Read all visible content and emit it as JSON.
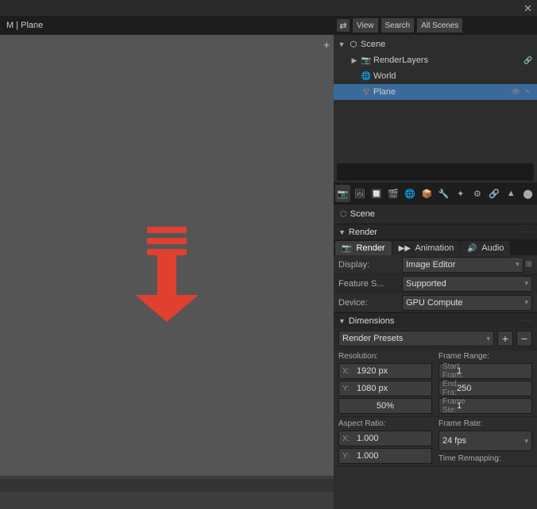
{
  "app": {
    "title": "M | Plane",
    "close_btn": "✕"
  },
  "outliner": {
    "header": {
      "view_label": "View",
      "search_label": "Search",
      "all_scenes_label": "All Scenes"
    },
    "items": [
      {
        "id": "scene",
        "label": "Scene",
        "indent": 0,
        "icon": "🎬",
        "has_arrow": true,
        "expanded": true
      },
      {
        "id": "renderlayers",
        "label": "RenderLayers",
        "indent": 1,
        "icon": "📷",
        "has_arrow": false,
        "expanded": false
      },
      {
        "id": "world",
        "label": "World",
        "indent": 1,
        "icon": "🌐",
        "has_arrow": false,
        "expanded": false
      },
      {
        "id": "plane",
        "label": "Plane",
        "indent": 1,
        "icon": "△",
        "has_arrow": false,
        "expanded": false,
        "selected": true
      }
    ]
  },
  "properties": {
    "scene_label": "Scene",
    "render_section": {
      "title": "Render",
      "dots": "···",
      "tabs": [
        {
          "id": "render",
          "label": "Render",
          "icon": "📷",
          "active": true
        },
        {
          "id": "animation",
          "label": "Animation",
          "icon": "🎞",
          "active": false
        },
        {
          "id": "audio",
          "label": "Audio",
          "icon": "🔊",
          "active": false
        }
      ],
      "rows": [
        {
          "label": "Display:",
          "value": "Image Editor",
          "has_icon": true
        },
        {
          "label": "Feature S...",
          "value": "Supported",
          "has_icon": false
        },
        {
          "label": "Device:",
          "value": "GPU Compute",
          "has_icon": false
        }
      ]
    },
    "dimensions_section": {
      "title": "Dimensions",
      "dots": "···",
      "presets_label": "Render Presets",
      "resolution_label": "Resolution:",
      "frame_range_label": "Frame Range:",
      "res_x_label": "X:",
      "res_x_value": "1920 px",
      "res_y_label": "Y:",
      "res_y_value": "1080 px",
      "res_percent": "50%",
      "start_frame_label": "Start Fram:",
      "start_frame_value": "1",
      "end_frame_label": "End Fra:",
      "end_frame_value": "250",
      "frame_step_label": "Frame Ste:",
      "frame_step_value": "1",
      "aspect_ratio_label": "Aspect Ratio:",
      "frame_rate_label": "Frame Rate:",
      "aspect_x_label": "X:",
      "aspect_x_value": "1.000",
      "aspect_y_label": "Y:",
      "aspect_y_value": "1.000",
      "frame_rate_value": "24 fps",
      "time_remapping_label": "Time Remapping:"
    }
  },
  "viewport": {
    "hamburger_lines": 3
  },
  "icons": {
    "arrow_down": "▼",
    "arrow_right": "▶",
    "chevron_down": "▾",
    "plus": "+",
    "minus": "−",
    "eye": "👁",
    "cursor": "↖",
    "camera": "📷",
    "render_icon": "🎬",
    "scene_icon": "🎬"
  }
}
